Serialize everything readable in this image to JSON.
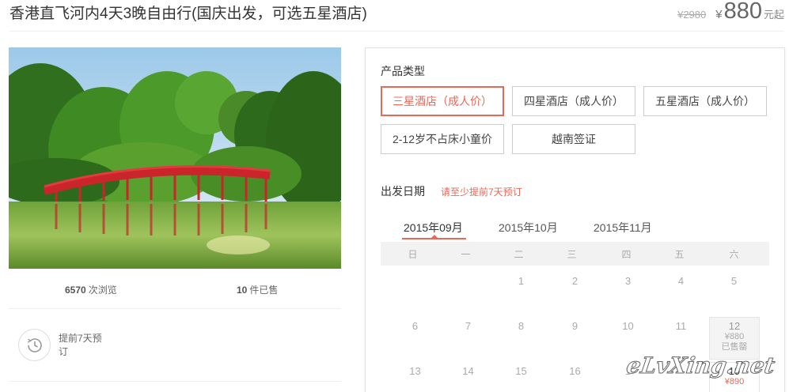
{
  "product": {
    "title": "香港直飞河内4天3晚自由行(国庆出发，可选五星酒店)",
    "old_price": "¥2980",
    "currency": "¥",
    "price": "880",
    "price_unit": "元起"
  },
  "stats": {
    "views_count": "6570",
    "views_label": "次浏览",
    "sold_count": "10",
    "sold_label": "件已售"
  },
  "booking": {
    "text": "提前7天预订",
    "icon": "clock-icon"
  },
  "product_type": {
    "title": "产品类型",
    "options": [
      {
        "label": "三星酒店（成人价）",
        "selected": true
      },
      {
        "label": "四星酒店（成人价）",
        "selected": false
      },
      {
        "label": "五星酒店（成人价）",
        "selected": false
      },
      {
        "label": "2-12岁不占床小童价",
        "selected": false
      },
      {
        "label": "越南签证",
        "selected": false
      }
    ]
  },
  "departure": {
    "title": "出发日期",
    "hint": "请至少提前7天预订",
    "months": [
      "2015年09月",
      "2015年10月",
      "2015年11月"
    ],
    "active_month": 0,
    "weekdays": [
      "日",
      "一",
      "二",
      "三",
      "四",
      "五",
      "六"
    ],
    "row1": [
      "1",
      "2",
      "3",
      "4",
      "5"
    ],
    "row2": [
      "6",
      "7",
      "8",
      "9",
      "10",
      "11"
    ],
    "row2_sat": {
      "day": "12",
      "price": "¥880",
      "status": "已售罄"
    },
    "row3": [
      "13",
      "14",
      "15",
      "16",
      "1"
    ],
    "row3_sat": {
      "day": "19",
      "price": "¥890"
    }
  },
  "watermark": "eLvXing.net",
  "colors": {
    "accent": "#e8685a",
    "border": "#cccccc",
    "weekbar": "#f2f2f2"
  }
}
